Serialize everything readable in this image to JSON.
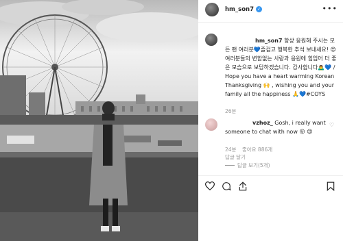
{
  "post": {
    "username": "hm_son7",
    "verified_badge": "check-icon"
  },
  "caption": {
    "username": "hm_son7",
    "korean": "항상 응원해 주시는 모든 팬 여러분💙즐겁고 행복한 추석 보내세요! 😍 여러분들의 변함없는 사랑과 응원에 힘입어 더 좋은 모습으로 보답하겠습니다. 감사합니다🙇‍♂️💙 /",
    "english": "Hope you have a heart warming Korean Thanksgiving 🙌 , wishing you and your family all the happiness 🙏💙#COYS",
    "time": "26분"
  },
  "comment": {
    "username": "vzhoz_",
    "text": "Gosh, i really want someone to chat with now 😛 😍",
    "time": "24분",
    "likes": "좋아요 886개",
    "reply": "답글 달기",
    "view_replies": "답글 보기(5개)"
  },
  "colors": {
    "verified": "#3897f0",
    "muted": "#999999",
    "text": "#262626"
  }
}
